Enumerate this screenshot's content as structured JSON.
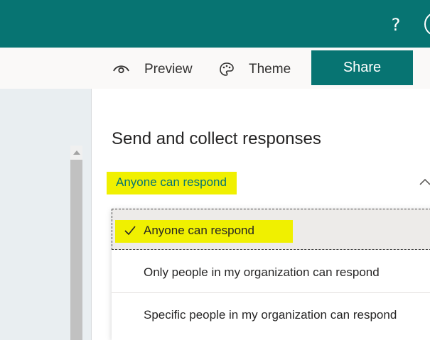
{
  "header": {
    "background": "#077472",
    "help_label": "?"
  },
  "toolbar": {
    "preview_label": "Preview",
    "theme_label": "Theme",
    "share_label": "Share",
    "preview_icon": "eye-icon",
    "theme_icon": "palette-icon"
  },
  "panel": {
    "title": "Send and collect responses",
    "selected_option": "Anyone can respond",
    "options": [
      {
        "label": "Anyone can respond",
        "selected": true
      },
      {
        "label": "Only people in my organization can respond",
        "selected": false
      },
      {
        "label": "Specific people in my organization can respond",
        "selected": false
      }
    ]
  },
  "colors": {
    "accent": "#077472",
    "highlight": "#f0f000"
  }
}
